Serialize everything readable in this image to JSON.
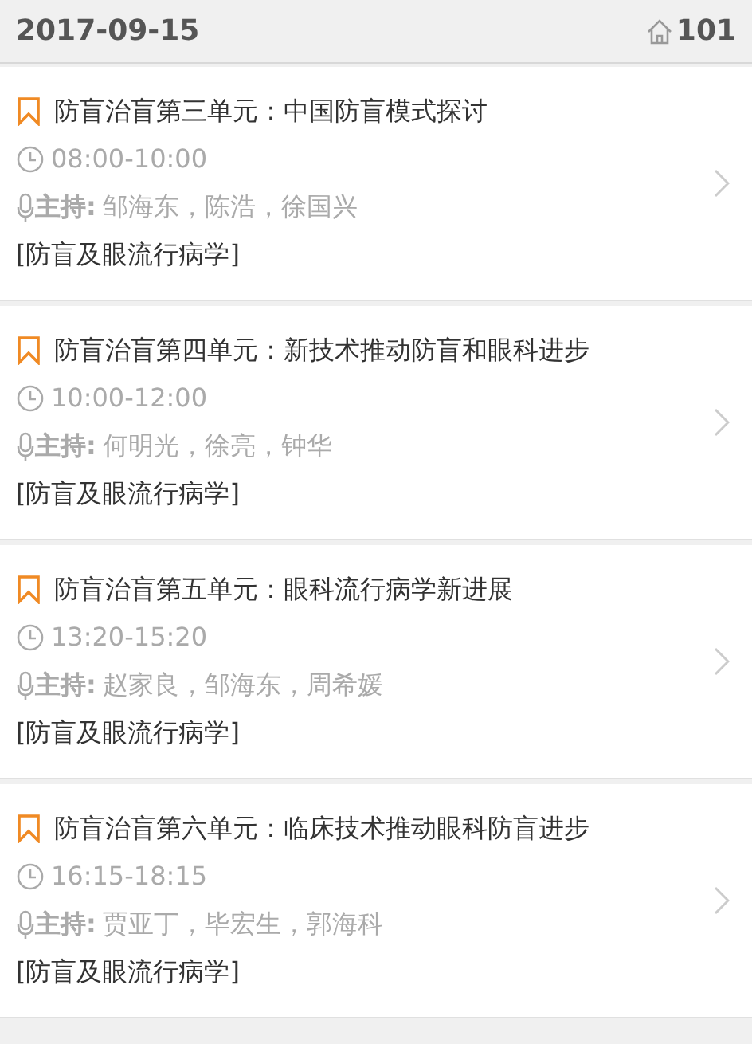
{
  "header": {
    "date": "2017-09-15",
    "room": "101"
  },
  "sessions": [
    {
      "title": "防盲治盲第三单元：中国防盲模式探讨",
      "time": "08:00-10:00",
      "host_label": "主持:",
      "hosts": "邹海东，陈浩，徐国兴",
      "category": "[防盲及眼流行病学]"
    },
    {
      "title": "防盲治盲第四单元：新技术推动防盲和眼科进步",
      "time": "10:00-12:00",
      "host_label": "主持:",
      "hosts": "何明光，徐亮，钟华",
      "category": "[防盲及眼流行病学]"
    },
    {
      "title": "防盲治盲第五单元：眼科流行病学新进展",
      "time": "13:20-15:20",
      "host_label": "主持:",
      "hosts": "赵家良，邹海东，周希媛",
      "category": "[防盲及眼流行病学]"
    },
    {
      "title": "防盲治盲第六单元：临床技术推动眼科防盲进步",
      "time": "16:15-18:15",
      "host_label": "主持:",
      "hosts": "贾亚丁，毕宏生，郭海科",
      "category": "[防盲及眼流行病学]"
    }
  ]
}
